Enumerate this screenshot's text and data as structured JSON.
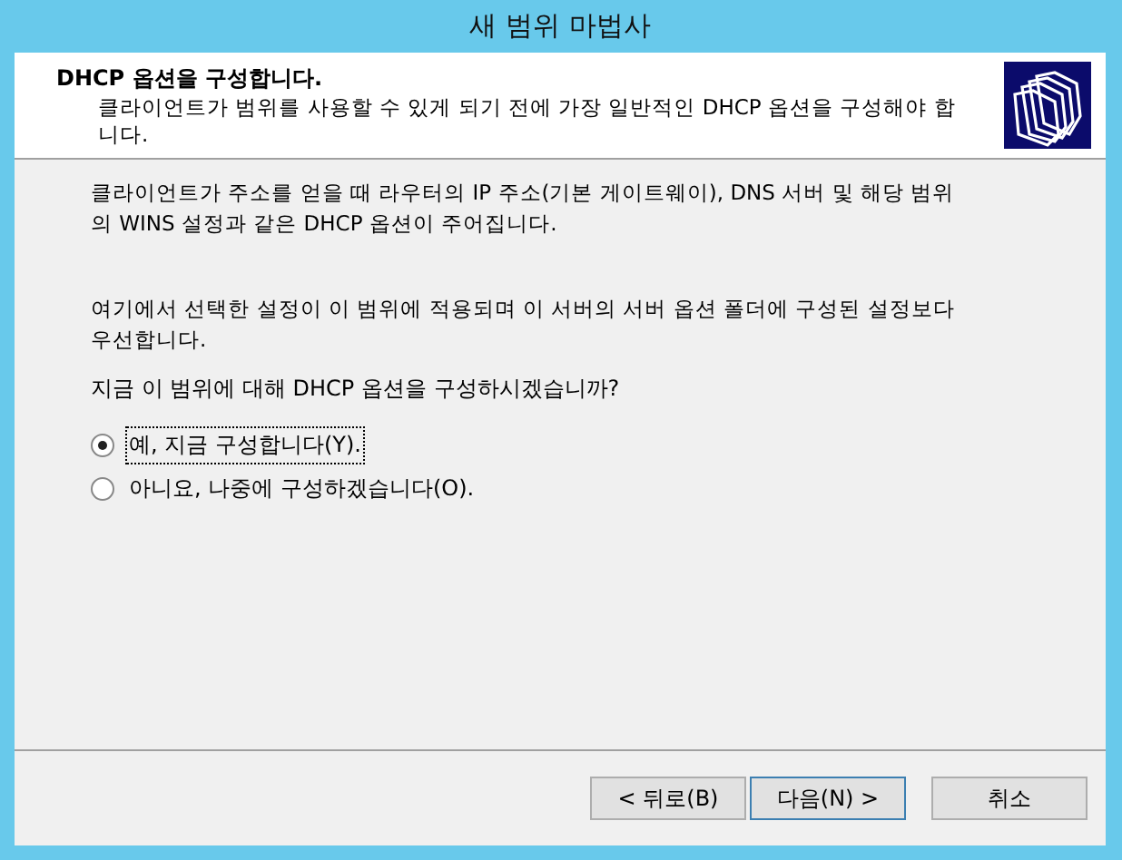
{
  "window": {
    "title": "새 범위 마법사"
  },
  "header": {
    "title": "DHCP 옵션을 구성합니다.",
    "subtitle": "클라이언트가 범위를 사용할 수 있게 되기 전에 가장 일반적인 DHCP 옵션을 구성해야 합니다."
  },
  "paragraphs": [
    "클라이언트가 주소를 얻을 때 라우터의 IP 주소(기본 게이트웨이), DNS 서버 및 해당 범위의 WINS 설정과 같은 DHCP 옵션이 주어집니다.",
    "여기에서 선택한 설정이 이 범위에 적용되며 이 서버의 서버 옵션 폴더에 구성된 설정보다 우선합니다."
  ],
  "question": "지금 이 범위에 대해 DHCP 옵션을 구성하시겠습니까?",
  "options": [
    {
      "label": "예, 지금 구성합니다(Y).",
      "selected": true
    },
    {
      "label": "아니요, 나중에 구성하겠습니다(O).",
      "selected": false
    }
  ],
  "buttons": [
    {
      "label": "< 뒤로(B)",
      "default": false
    },
    {
      "label": "다음(N) >",
      "default": true
    },
    {
      "label": "취소",
      "default": false
    }
  ]
}
